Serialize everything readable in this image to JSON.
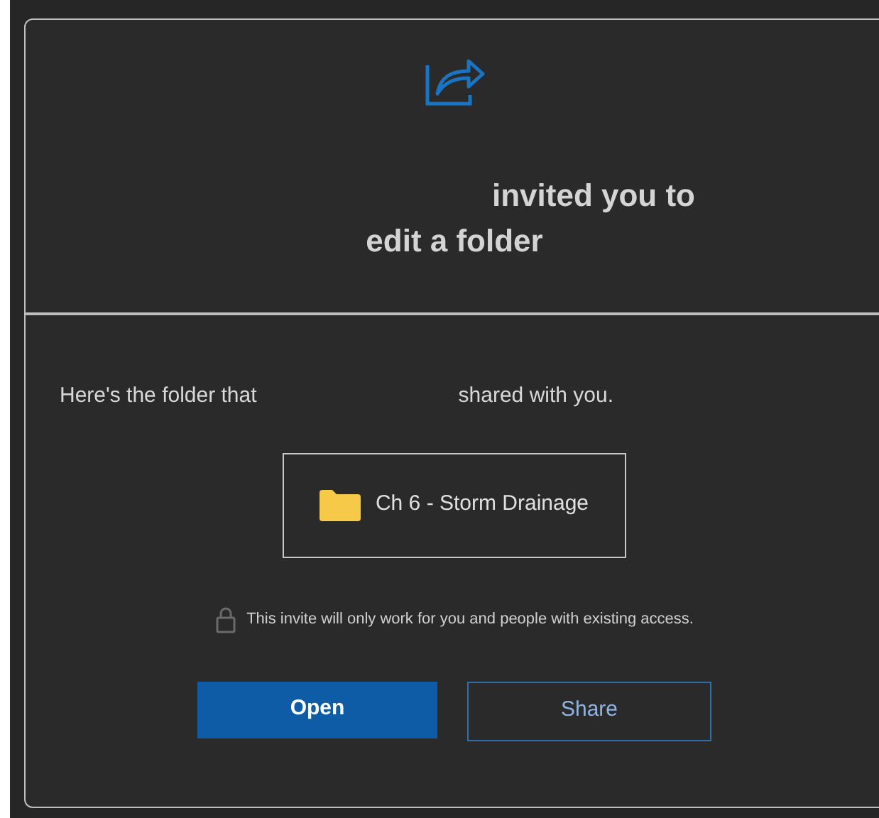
{
  "header": {
    "line_1": "invited you to",
    "line_2": "edit a folder"
  },
  "message": {
    "before": "Here's the folder that",
    "after": "shared with you."
  },
  "folder": {
    "name": "Ch 6 - Storm Drainage"
  },
  "notice": "This invite will only work for you and people with existing access.",
  "buttons": [
    {
      "label": "Open",
      "kind": "primary"
    },
    {
      "label": "Share",
      "kind": "secondary"
    }
  ]
}
